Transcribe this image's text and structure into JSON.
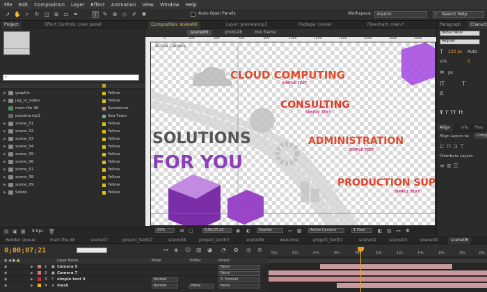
{
  "menu": [
    "File",
    "Edit",
    "Composition",
    "Layer",
    "Effect",
    "Animation",
    "View",
    "Window",
    "Help"
  ],
  "toolbar": {
    "auto_open": "Auto-Open Panels",
    "workspace_label": "Workspace:",
    "workspace_value": "marcin",
    "search": "Search Help"
  },
  "project_panel": {
    "tabs": [
      "Project",
      "Effect Controls: color panel"
    ],
    "items": [
      {
        "name": "graphic",
        "label": "Yellow",
        "color": "#d6c21a"
      },
      {
        "name": "jpg_or_video",
        "label": "Yellow",
        "color": "#d6c21a"
      },
      {
        "name": "main file AE",
        "label": "Sandstone",
        "color": "#a8957a"
      },
      {
        "name": "preview.mp3",
        "label": "Sea Foam",
        "color": "#6fb0a0"
      },
      {
        "name": "scene_01",
        "label": "Yellow",
        "color": "#d6c21a"
      },
      {
        "name": "scene_02",
        "label": "Yellow",
        "color": "#d6c21a"
      },
      {
        "name": "scene_03",
        "label": "Yellow",
        "color": "#d6c21a"
      },
      {
        "name": "scene_04",
        "label": "Yellow",
        "color": "#d6c21a"
      },
      {
        "name": "scene_05",
        "label": "Yellow",
        "color": "#d6c21a"
      },
      {
        "name": "scene_06",
        "label": "Yellow",
        "color": "#d6c21a"
      },
      {
        "name": "scene_07",
        "label": "Yellow",
        "color": "#d6c21a"
      },
      {
        "name": "scene_08",
        "label": "Yellow",
        "color": "#d6c21a"
      },
      {
        "name": "scene_09",
        "label": "Yellow",
        "color": "#d6c21a"
      },
      {
        "name": "Solids",
        "label": "Yellow",
        "color": "#d6c21a"
      }
    ],
    "bpc": "8 bpc"
  },
  "comp_panel": {
    "tabs": [
      "Composition: scene06",
      "Layer: preview.mp3",
      "Footage: (none)",
      "Flowchart: main f"
    ],
    "breadcrumbs": [
      "scene06",
      "photo28",
      "box frame"
    ],
    "ruler": [
      "0",
      "200",
      "400",
      "600",
      "800",
      "1000",
      "1200",
      "1400",
      "1600",
      "1800",
      "2000"
    ],
    "active_camera": "Active Camera",
    "footer": {
      "zoom": "25%",
      "time": "0;00;07;23",
      "quality": "Quarter",
      "view": "Active Camera",
      "views": "1 View"
    }
  },
  "comp_words": {
    "cloud": "CLOUD COMPUTING",
    "consulting": "CONSULTING",
    "admin": "ADMINISTRATION",
    "production": "PRODUCTION SUPPLIES",
    "solutions": "SOLUTIONS",
    "foryou": "FOR YOU",
    "sub": "SIMPLE TEXT"
  },
  "right_panel": {
    "tabs": [
      "Paragraph",
      "Charact"
    ],
    "font": "Bebas Neue",
    "style": "Regular",
    "size": "120 px",
    "leading": "Auto",
    "tracking": "0",
    "unit": "px",
    "align_tabs": [
      "Align",
      "Info",
      "Prev"
    ],
    "align_layers": "Align Layers to:",
    "align_target": "Compo",
    "distribute": "Distribute Layers:"
  },
  "timeline": {
    "tabs": [
      "Render Queue",
      "main file AE",
      "scene07",
      "project_text02",
      "scene08",
      "project_text03",
      "scene09",
      "welcome",
      "project_text01",
      "scene01",
      "scene03",
      "scene04",
      "scene06"
    ],
    "timecode": "0;00;07;21",
    "columns": {
      "name": "Layer Name",
      "mode": "Mode",
      "trkmat": "TrkMat",
      "parent": "Parent"
    },
    "layers": [
      {
        "num": "1",
        "name": "Camera 5",
        "mode": "",
        "trkmat": "",
        "parent": "None",
        "color": "#d67b7b"
      },
      {
        "num": "2",
        "name": "Camera 7",
        "mode": "",
        "trkmat": "",
        "parent": "None",
        "color": "#d67b7b"
      },
      {
        "num": "3",
        "name": "simple text 4",
        "mode": "Normal",
        "trkmat": "",
        "parent": "5. Product",
        "color": "#cc3030"
      },
      {
        "num": "4",
        "name": "mask",
        "mode": "Normal",
        "trkmat": "None",
        "parent": "None",
        "color": "#d6c21a"
      }
    ],
    "ruler": [
      "00s",
      "02s",
      "04s",
      "06s",
      "08s",
      "10s",
      "12s",
      "14s",
      "16s",
      "18s",
      "20s"
    ]
  },
  "colors": {
    "accent": "#e8a020",
    "purple": "#8a3fb8",
    "red": "#e04428"
  }
}
